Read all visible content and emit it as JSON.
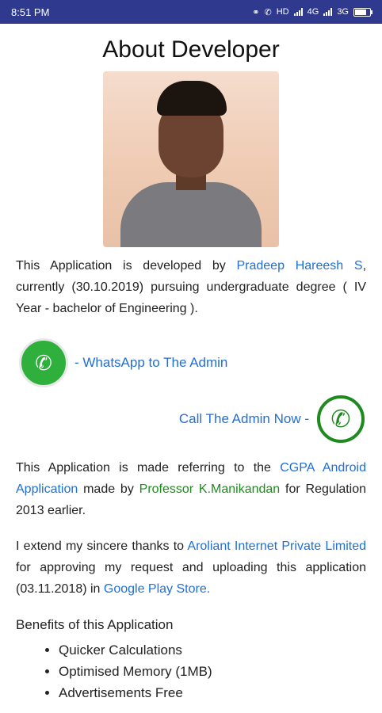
{
  "status_bar": {
    "time": "8:51 PM",
    "network_hd": "HD",
    "network_4g": "4G",
    "network_3g": "3G",
    "icons": [
      "link-icon",
      "call-indicator-icon",
      "signal-icon",
      "signal-icon",
      "battery-icon"
    ]
  },
  "page": {
    "title": "About Developer",
    "photo_icon": "developer-photo"
  },
  "intro": {
    "prefix": "This Application is developed by ",
    "developer_name": "Pradeep Hareesh S",
    "suffix": ", currently (30.10.2019) pursuing undergraduate degree ( IV Year - bachelor of Engineering )."
  },
  "contact": {
    "whatsapp_label": "- WhatsApp to The Admin",
    "call_label": "Call The Admin Now -",
    "whatsapp_icon": "whatsapp-icon",
    "call_icon": "phone-icon"
  },
  "reference": {
    "prefix": "This Application is made referring to the ",
    "app_name": "CGPA Android Application",
    "middle": " made by ",
    "professor": "Professor K.Manikandan",
    "suffix": " for Regulation 2013 earlier."
  },
  "thanks": {
    "prefix": "I extend my sincere thanks to ",
    "company": "Aroliant Internet Private Limited",
    "middle": " for approving my request and uploading this application (03.11.2018) in ",
    "store": "Google Play Store."
  },
  "benefits": {
    "title": "Benefits of this Application",
    "items": [
      "Quicker Calculations",
      "Optimised Memory (1MB)",
      "Advertisements Free"
    ]
  },
  "colors": {
    "status_bar": "#2f3a8f",
    "link_blue": "#1e6fd9",
    "link_green": "#1e8a1e",
    "whatsapp_green": "#2fb03c"
  }
}
